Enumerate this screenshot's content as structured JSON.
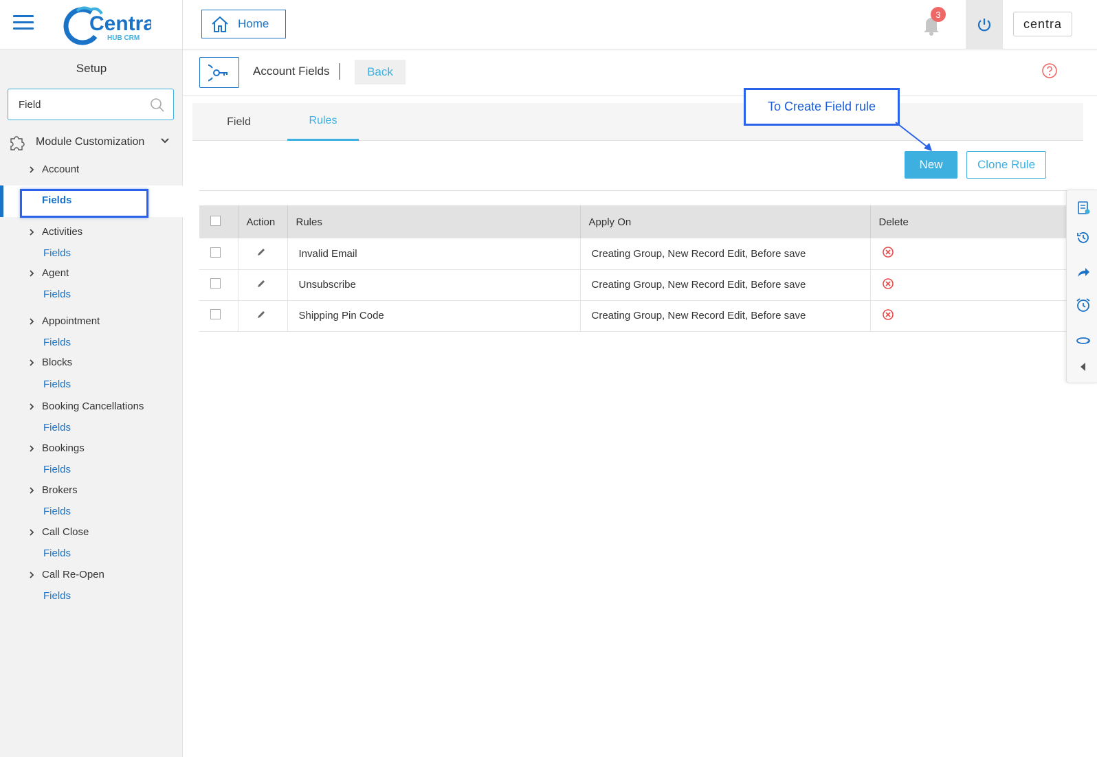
{
  "header": {
    "logo_text": "Centra",
    "logo_sub": "HUB CRM",
    "home_label": "Home",
    "notification_count": "3",
    "brand_text": "centra"
  },
  "sidebar": {
    "title": "Setup",
    "search_value": "Field",
    "module_label": "Module Customization",
    "items": [
      {
        "label": "Account",
        "link": "Fields"
      },
      {
        "label": "Activities",
        "link": "Fields"
      },
      {
        "label": "Agent",
        "link": "Fields"
      },
      {
        "label": "Appointment",
        "link": "Fields"
      },
      {
        "label": "Blocks",
        "link": "Fields"
      },
      {
        "label": "Booking Cancellations",
        "link": "Fields"
      },
      {
        "label": "Bookings",
        "link": "Fields"
      },
      {
        "label": "Brokers",
        "link": "Fields"
      },
      {
        "label": "Call Close",
        "link": "Fields"
      },
      {
        "label": "Call Re-Open",
        "link": "Fields"
      }
    ]
  },
  "page": {
    "title": "Account Fields",
    "back_label": "Back",
    "tabs": [
      {
        "label": "Field"
      },
      {
        "label": "Rules"
      }
    ],
    "callout": "To Create Field rule",
    "new_label": "New",
    "clone_label": "Clone Rule"
  },
  "table": {
    "headers": [
      "Action",
      "Rules",
      "Apply On",
      "Delete"
    ],
    "rows": [
      {
        "rule": "Invalid Email",
        "apply_on": "Creating Group,  New Record Edit, Before save"
      },
      {
        "rule": "Unsubscribe",
        "apply_on": "Creating Group,  New Record Edit, Before save"
      },
      {
        "rule": "Shipping Pin Code",
        "apply_on": "Creating Group,  New Record Edit, Before save"
      }
    ]
  },
  "colors": {
    "primary": "#1a73c6",
    "accent": "#3db0e0",
    "highlight": "#2b63e8",
    "danger": "#f06767"
  },
  "icons": {
    "menu": "hamburger-icon",
    "home": "home-icon",
    "bell": "bell-icon",
    "power": "power-icon",
    "search": "search-icon",
    "module": "puzzle-icon",
    "key": "key-icon",
    "help": "help-icon",
    "edit": "pencil-icon",
    "delete": "delete-circle-icon"
  }
}
